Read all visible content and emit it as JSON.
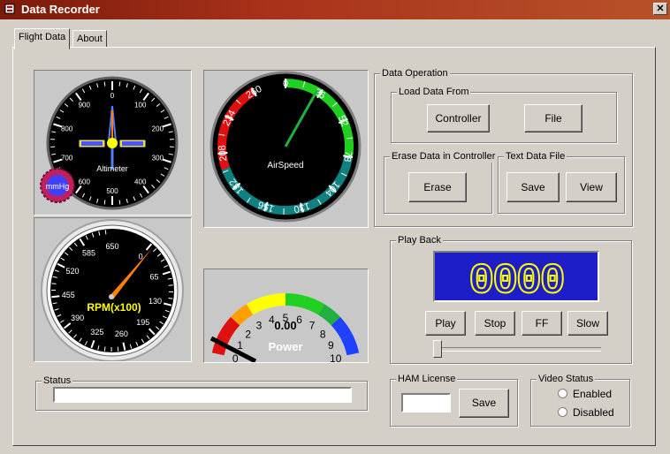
{
  "window": {
    "title": "Data Recorder",
    "close_glyph": "✕"
  },
  "tabs": [
    {
      "label": "Flight Data",
      "active": true
    },
    {
      "label": "About",
      "active": false
    }
  ],
  "altimeter": {
    "label": "Altimeter",
    "ticks": [
      "0",
      "100",
      "200",
      "300",
      "400",
      "500",
      "600",
      "700",
      "800",
      "900"
    ],
    "badge": "mmHg"
  },
  "airspeed": {
    "label": "AirSpeed",
    "ticks": [
      "0",
      "26",
      "52",
      "78",
      "104",
      "130",
      "156",
      "182",
      "208",
      "234",
      "260"
    ]
  },
  "rpm": {
    "label": "RPM(x100)",
    "ticks": [
      "0",
      "65",
      "130",
      "195",
      "260",
      "325",
      "390",
      "455",
      "520",
      "585",
      "650"
    ]
  },
  "power": {
    "label": "Power",
    "value": "0.00",
    "ticks": [
      "0",
      "1",
      "2",
      "3",
      "4",
      "5",
      "6",
      "7",
      "8",
      "9",
      "10"
    ]
  },
  "data_operation": {
    "title": "Data Operation",
    "load_group": {
      "title": "Load Data From",
      "controller_label": "Controller",
      "file_label": "File"
    },
    "erase_group": {
      "title": "Erase Data in Controller",
      "erase_label": "Erase"
    },
    "text_group": {
      "title": "Text Data File",
      "save_label": "Save",
      "view_label": "View"
    }
  },
  "playback": {
    "title": "Play Back",
    "counter": "0000",
    "play_label": "Play",
    "stop_label": "Stop",
    "ff_label": "FF",
    "slow_label": "Slow",
    "position": 0
  },
  "status": {
    "title": "Status",
    "value": ""
  },
  "ham_license": {
    "title": "HAM License",
    "value": "",
    "save_label": "Save"
  },
  "video_status": {
    "title": "Video Status",
    "enabled_label": "Enabled",
    "disabled_label": "Disabled"
  },
  "colors": {
    "titlebar": "#7a1a0a",
    "lcd_bg": "#1e1ec8",
    "lcd_digit": "#ffff00",
    "needle": "#ff8000",
    "airspeed_needle": "#20b040"
  }
}
